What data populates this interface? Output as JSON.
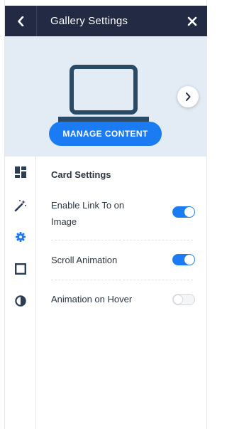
{
  "header": {
    "title": "Gallery Settings",
    "back_icon": "chevron-left-icon",
    "close_icon": "close-icon"
  },
  "preview": {
    "device_icon": "laptop-icon",
    "next_icon": "chevron-right-icon",
    "manage_button_label": "MANAGE CONTENT"
  },
  "sidebar": {
    "items": [
      {
        "icon": "layout-icon",
        "active": false
      },
      {
        "icon": "magic-wand-icon",
        "active": false
      },
      {
        "icon": "gear-icon",
        "active": true
      },
      {
        "icon": "square-icon",
        "active": false
      },
      {
        "icon": "contrast-icon",
        "active": false
      }
    ]
  },
  "card_settings": {
    "title": "Card Settings",
    "options": [
      {
        "line1": "Enable Link To on",
        "line2": "Image",
        "enabled": true
      },
      {
        "label": "Scroll Animation",
        "enabled": true
      },
      {
        "label": "Animation on Hover",
        "enabled": false
      }
    ]
  },
  "colors": {
    "header_bg": "#222a44",
    "accent": "#1a7bf2",
    "preview_bg": "#e3ebf4",
    "icon_dark": "#2b3d57"
  }
}
